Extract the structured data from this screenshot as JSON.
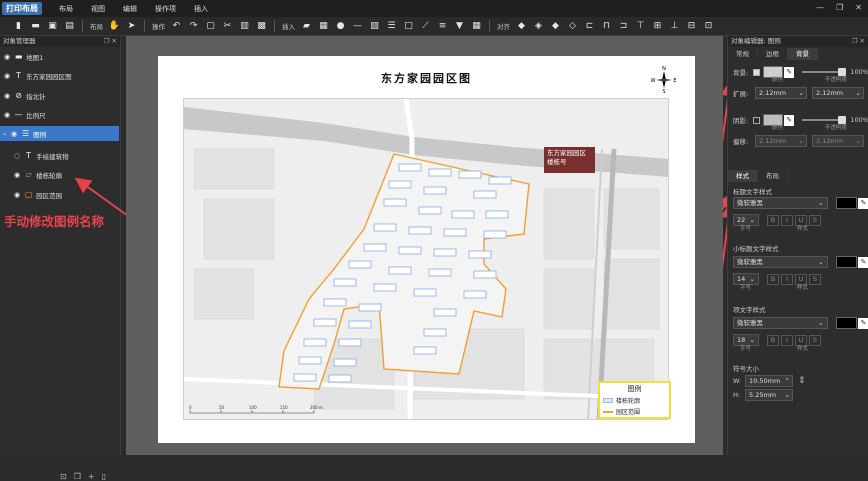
{
  "titlebar": {
    "app_title": "打印布局",
    "menu": [
      "布局",
      "视图",
      "编辑",
      "操作项",
      "插入"
    ]
  },
  "toolbar": {
    "group_labels": {
      "layout": "布局",
      "operate": "操作",
      "insert": "插入",
      "align": "对齐"
    }
  },
  "left_panel": {
    "title": "对象管理器",
    "items": [
      {
        "label": "地图1",
        "icon": "folder-icon"
      },
      {
        "label": "东方家园园区图",
        "icon": "text-icon"
      },
      {
        "label": "指北针",
        "icon": "compass-icon"
      },
      {
        "label": "比例尺",
        "icon": "scale-icon"
      },
      {
        "label": "图例",
        "icon": "legend-icon"
      },
      {
        "label": "手绘建筑物",
        "icon": "text-icon"
      },
      {
        "label": "楼栋轮廓",
        "icon": "polygon-icon"
      },
      {
        "label": "园区范围",
        "icon": "region-icon"
      }
    ],
    "annotation": "手动修改图例名称"
  },
  "page": {
    "title": "东方家园园区图",
    "compass_letters": {
      "n": "N",
      "s": "S",
      "e": "E",
      "w": "W"
    },
    "callout": {
      "line1": "东方家园园区",
      "line2": "楼栋号"
    },
    "scale_labels": [
      "0",
      "50",
      "100",
      "150",
      "200 m"
    ],
    "legend": {
      "title": "图例",
      "items": [
        {
          "label": "楼栋轮廓",
          "color": "#9cb8e8"
        },
        {
          "label": "园区范围",
          "color": "#f0a030"
        }
      ]
    }
  },
  "right_panel": {
    "title": "对象编辑器: 图例",
    "tabs": [
      "常规",
      "边框",
      "背景"
    ],
    "background": {
      "label": "背景:",
      "opacity": "100%",
      "color_caption": "颜色",
      "opacity_caption": "不透明度",
      "expand_label": "扩展:",
      "expand_x": "2.12mm",
      "expand_y": "2.12mm"
    },
    "shadow": {
      "label": "阴影:",
      "opacity": "100%",
      "color_caption": "颜色",
      "opacity_caption": "不透明度",
      "offset_label": "偏移:",
      "offset_x": "2.12mm",
      "offset_y": "2.12mm"
    },
    "tabs2": [
      "样式",
      "布局"
    ],
    "title_style": {
      "label": "标题文字样式",
      "font": "微软雅黑",
      "size": "22",
      "size_caption": "字号",
      "style_caption": "样式"
    },
    "subtitle_style": {
      "label": "小标题文字样式",
      "font": "微软雅黑",
      "size": "14",
      "size_caption": "字号",
      "style_caption": "样式"
    },
    "item_style": {
      "label": "项文字样式",
      "font": "微软雅黑",
      "size": "18",
      "size_caption": "字号",
      "style_caption": "样式"
    },
    "symbol_size": {
      "label": "符号大小",
      "w_label": "W:",
      "w": "10.50mm",
      "h_label": "H:",
      "h": "5.25mm"
    },
    "format_buttons": [
      "B",
      "I",
      "U",
      "S"
    ]
  }
}
